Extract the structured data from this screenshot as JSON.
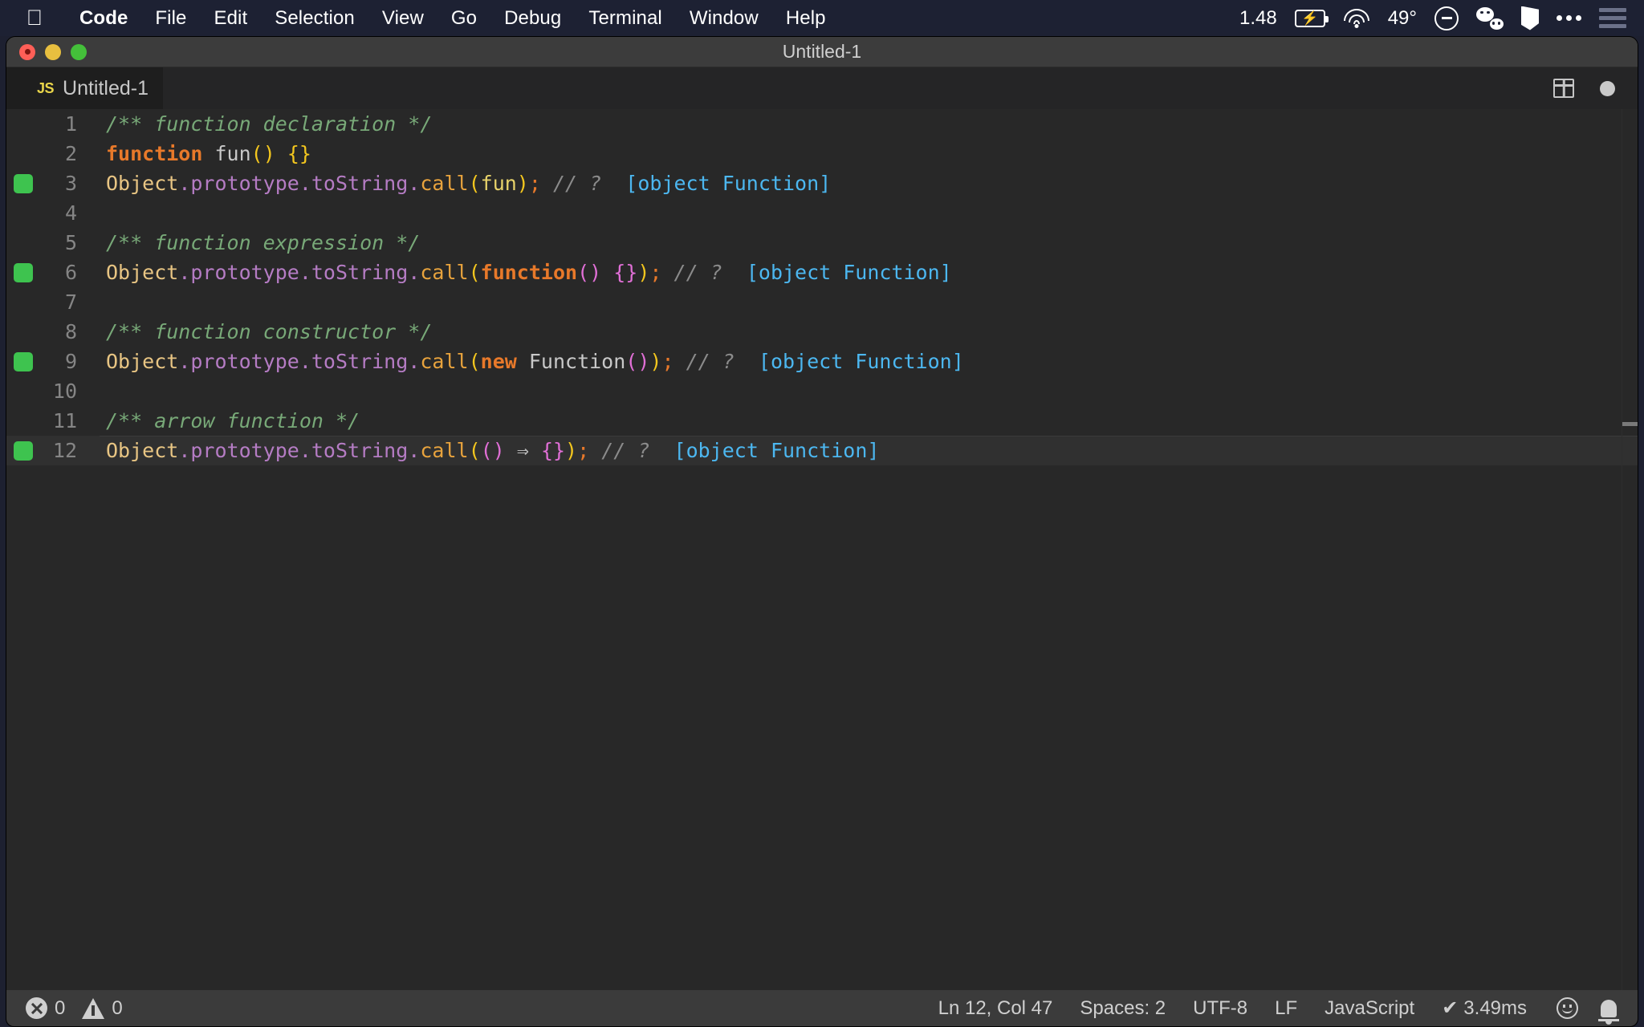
{
  "menubar": {
    "apple_glyph": "",
    "items": [
      {
        "label": "Code",
        "bold": true
      },
      {
        "label": "File",
        "bold": false
      },
      {
        "label": "Edit",
        "bold": false
      },
      {
        "label": "Selection",
        "bold": false
      },
      {
        "label": "View",
        "bold": false
      },
      {
        "label": "Go",
        "bold": false
      },
      {
        "label": "Debug",
        "bold": false
      },
      {
        "label": "Terminal",
        "bold": false
      },
      {
        "label": "Window",
        "bold": false
      },
      {
        "label": "Help",
        "bold": false
      }
    ],
    "status": {
      "time_or_version": "1.48",
      "battery_icon": "battery-charging-icon",
      "wifi_icon": "wifi-icon",
      "temperature": "49°",
      "dnd_icon": "do-not-disturb-icon",
      "wechat_icon": "wechat-icon",
      "shield_icon": "shield-icon",
      "more_icon": "ellipsis-icon",
      "controlcenter_icon": "list-menu-icon"
    }
  },
  "window": {
    "title": "Untitled-1",
    "traffic_lights": [
      "close-button",
      "minimize-button",
      "zoom-button"
    ]
  },
  "tabbar": {
    "active_tab": {
      "badge": "JS",
      "label": "Untitled-1"
    },
    "actions": {
      "split_editor": "split-editor-icon",
      "unsaved_indicator": "dirty-dot-icon"
    }
  },
  "editor": {
    "language": "JavaScript",
    "lines": [
      {
        "number": "1",
        "marker": false,
        "current": false,
        "tokens": [
          {
            "t": "/** function declaration */",
            "c": "c-comment"
          }
        ]
      },
      {
        "number": "2",
        "marker": false,
        "current": false,
        "tokens": [
          {
            "t": "function",
            "c": "c-kw"
          },
          {
            "t": " ",
            "c": "c-punc"
          },
          {
            "t": "fun",
            "c": "c-ident"
          },
          {
            "t": "()",
            "c": "c-paren-y"
          },
          {
            "t": " ",
            "c": "c-punc"
          },
          {
            "t": "{}",
            "c": "c-paren-y"
          }
        ]
      },
      {
        "number": "3",
        "marker": true,
        "current": false,
        "tokens": [
          {
            "t": "Object",
            "c": "c-obj"
          },
          {
            "t": ".prototype",
            "c": "c-prop"
          },
          {
            "t": ".toString",
            "c": "c-prop"
          },
          {
            "t": ".",
            "c": "c-prop"
          },
          {
            "t": "call",
            "c": "c-fn"
          },
          {
            "t": "(",
            "c": "c-paren-y"
          },
          {
            "t": "fun",
            "c": "c-var"
          },
          {
            "t": ")",
            "c": "c-paren-y"
          },
          {
            "t": ";",
            "c": "c-paren-o"
          },
          {
            "t": " // ?",
            "c": "c-slashcomment"
          },
          {
            "t": "  ",
            "c": "c-punc"
          },
          {
            "t": "[object Function]",
            "c": "c-result"
          }
        ]
      },
      {
        "number": "4",
        "marker": false,
        "current": false,
        "tokens": []
      },
      {
        "number": "5",
        "marker": false,
        "current": false,
        "tokens": [
          {
            "t": "/** function expression */",
            "c": "c-comment"
          }
        ]
      },
      {
        "number": "6",
        "marker": true,
        "current": false,
        "tokens": [
          {
            "t": "Object",
            "c": "c-obj"
          },
          {
            "t": ".prototype",
            "c": "c-prop"
          },
          {
            "t": ".toString",
            "c": "c-prop"
          },
          {
            "t": ".",
            "c": "c-prop"
          },
          {
            "t": "call",
            "c": "c-fn"
          },
          {
            "t": "(",
            "c": "c-paren-y"
          },
          {
            "t": "function",
            "c": "c-kw"
          },
          {
            "t": "()",
            "c": "c-paren-m"
          },
          {
            "t": " ",
            "c": "c-punc"
          },
          {
            "t": "{}",
            "c": "c-paren-m"
          },
          {
            "t": ")",
            "c": "c-paren-y"
          },
          {
            "t": ";",
            "c": "c-paren-o"
          },
          {
            "t": " // ?",
            "c": "c-slashcomment"
          },
          {
            "t": "  ",
            "c": "c-punc"
          },
          {
            "t": "[object Function]",
            "c": "c-result"
          }
        ]
      },
      {
        "number": "7",
        "marker": false,
        "current": false,
        "tokens": []
      },
      {
        "number": "8",
        "marker": false,
        "current": false,
        "tokens": [
          {
            "t": "/** function constructor */",
            "c": "c-comment"
          }
        ]
      },
      {
        "number": "9",
        "marker": true,
        "current": false,
        "tokens": [
          {
            "t": "Object",
            "c": "c-obj"
          },
          {
            "t": ".prototype",
            "c": "c-prop"
          },
          {
            "t": ".toString",
            "c": "c-prop"
          },
          {
            "t": ".",
            "c": "c-prop"
          },
          {
            "t": "call",
            "c": "c-fn"
          },
          {
            "t": "(",
            "c": "c-paren-y"
          },
          {
            "t": "new",
            "c": "c-kw"
          },
          {
            "t": " ",
            "c": "c-punc"
          },
          {
            "t": "Function",
            "c": "c-ident"
          },
          {
            "t": "()",
            "c": "c-paren-m"
          },
          {
            "t": ")",
            "c": "c-paren-y"
          },
          {
            "t": ";",
            "c": "c-paren-o"
          },
          {
            "t": " // ?",
            "c": "c-slashcomment"
          },
          {
            "t": "  ",
            "c": "c-punc"
          },
          {
            "t": "[object Function]",
            "c": "c-result"
          }
        ]
      },
      {
        "number": "10",
        "marker": false,
        "current": false,
        "tokens": []
      },
      {
        "number": "11",
        "marker": false,
        "current": false,
        "tokens": [
          {
            "t": "/** arrow function */",
            "c": "c-comment"
          }
        ]
      },
      {
        "number": "12",
        "marker": true,
        "current": true,
        "tokens": [
          {
            "t": "Object",
            "c": "c-obj"
          },
          {
            "t": ".prototype",
            "c": "c-prop"
          },
          {
            "t": ".toString",
            "c": "c-prop"
          },
          {
            "t": ".",
            "c": "c-prop"
          },
          {
            "t": "call",
            "c": "c-fn"
          },
          {
            "t": "(",
            "c": "c-paren-y"
          },
          {
            "t": "()",
            "c": "c-paren-m"
          },
          {
            "t": " ",
            "c": "c-punc"
          },
          {
            "t": "⇒",
            "c": "c-arrow"
          },
          {
            "t": " ",
            "c": "c-punc"
          },
          {
            "t": "{}",
            "c": "c-paren-m"
          },
          {
            "t": ")",
            "c": "c-paren-y"
          },
          {
            "t": ";",
            "c": "c-paren-o"
          },
          {
            "t": " // ?",
            "c": "c-slashcomment"
          },
          {
            "t": "  ",
            "c": "c-punc"
          },
          {
            "t": "[object Function]",
            "c": "c-result"
          }
        ]
      }
    ]
  },
  "statusbar": {
    "errors": "0",
    "warnings": "0",
    "cursor_position": "Ln 12, Col 47",
    "indentation": "Spaces: 2",
    "encoding": "UTF-8",
    "eol": "LF",
    "language_mode": "JavaScript",
    "run_time": "3.49ms",
    "run_check_glyph": "✔",
    "feedback_icon": "smiley-icon",
    "notifications_icon": "bell-icon"
  },
  "colors": {
    "menubar_bg": "#1d2133",
    "titlebar_bg": "#3c3c3c",
    "tabbar_bg": "#252526",
    "tab_active_bg": "#1e1e1e",
    "editor_bg": "#282828",
    "statusbar_bg": "#3b3b3b",
    "marker_green": "#3ec34f",
    "result_blue": "#4cb7f0",
    "comment_green": "#78a978"
  }
}
